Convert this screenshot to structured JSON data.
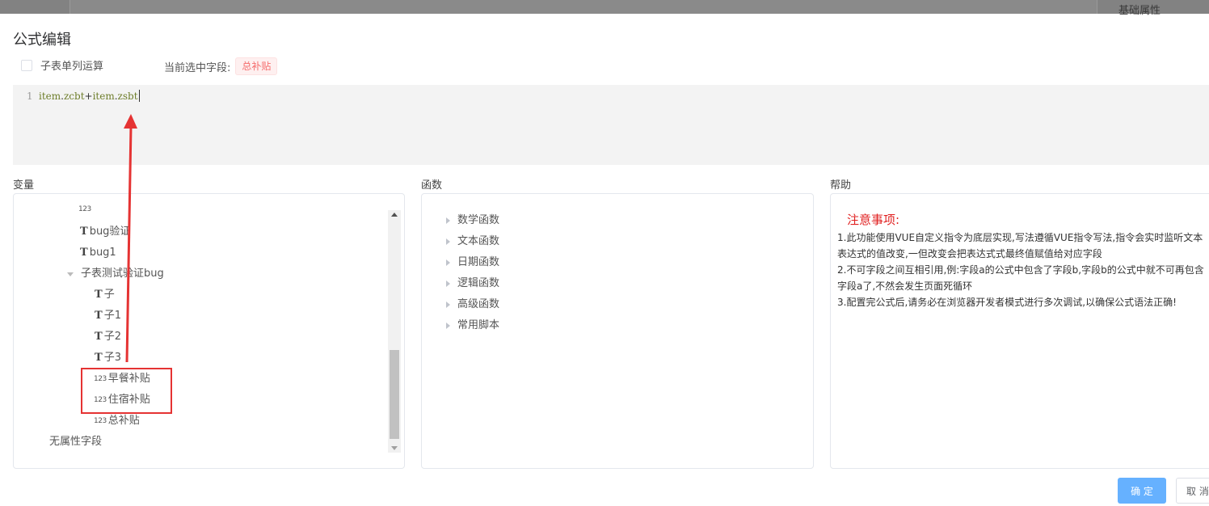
{
  "background": {
    "label": "基础属性"
  },
  "dialog": {
    "title": "公式编辑"
  },
  "subtable_checkbox": {
    "label": "子表单列运算",
    "checked": false
  },
  "current_field": {
    "label": "当前选中字段:",
    "value": "总补贴"
  },
  "editor": {
    "line_number": "1",
    "tokens": [
      "item",
      ".",
      "zcbt",
      "+",
      "item",
      ".",
      "zsbt"
    ]
  },
  "panels": {
    "variables": {
      "label": "变量",
      "nodes": [
        {
          "icon": "T",
          "label": "bug验证"
        },
        {
          "icon": "T",
          "label": "bug1"
        },
        {
          "icon": "",
          "label": "子表测试验证bug"
        },
        {
          "icon": "T",
          "label": "子"
        },
        {
          "icon": "T",
          "label": "子1"
        },
        {
          "icon": "T",
          "label": "子2"
        },
        {
          "icon": "T",
          "label": "子3"
        },
        {
          "icon": "123",
          "label": "早餐补贴"
        },
        {
          "icon": "123",
          "label": "住宿补贴"
        },
        {
          "icon": "123",
          "label": "总补贴"
        },
        {
          "icon": "",
          "label": "无属性字段"
        }
      ]
    },
    "functions": {
      "label": "函数",
      "items": [
        "数学函数",
        "文本函数",
        "日期函数",
        "逻辑函数",
        "高级函数",
        "常用脚本"
      ]
    },
    "help": {
      "label": "帮助",
      "title": "注意事项:",
      "lines": [
        "1.此功能使用VUE自定义指令为底层实现,写法遵循VUE指令写法,指令会实时监听文本表达式的值改变,一但改变会把表达式式最终值赋值给对应字段",
        "2.不可字段之间互相引用,例:字段a的公式中包含了字段b,字段b的公式中就不可再包含字段a了,不然会发生页面死循环",
        "3.配置完公式后,请务必在浏览器开发者模式进行多次调试,以确保公式语法正确!"
      ]
    }
  },
  "buttons": {
    "confirm": "确 定",
    "cancel": "取 消"
  },
  "colors": {
    "accent": "#66b1ff",
    "tag_red": "#f56c6c",
    "annotation_red": "#e53333",
    "help_title": "#e02020"
  }
}
